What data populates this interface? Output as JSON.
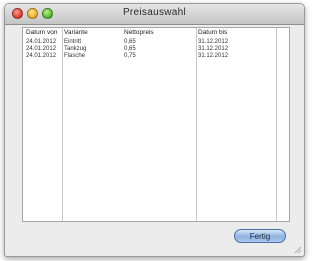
{
  "window": {
    "title": "Preisauswahl"
  },
  "table": {
    "columns": [
      "Datum von",
      "Variante",
      "Nettopreis",
      "Datum bis"
    ],
    "rows": [
      [
        "24.01.2012",
        "Eintritt",
        "0,65",
        "31.12.2012"
      ],
      [
        "24.01.2012",
        "Tankzug",
        "0,65",
        "31.12.2012"
      ],
      [
        "24.01.2012",
        "Flasche",
        "0,75",
        "31.12.2012"
      ]
    ]
  },
  "buttons": {
    "fertig_label": "Fertig"
  }
}
